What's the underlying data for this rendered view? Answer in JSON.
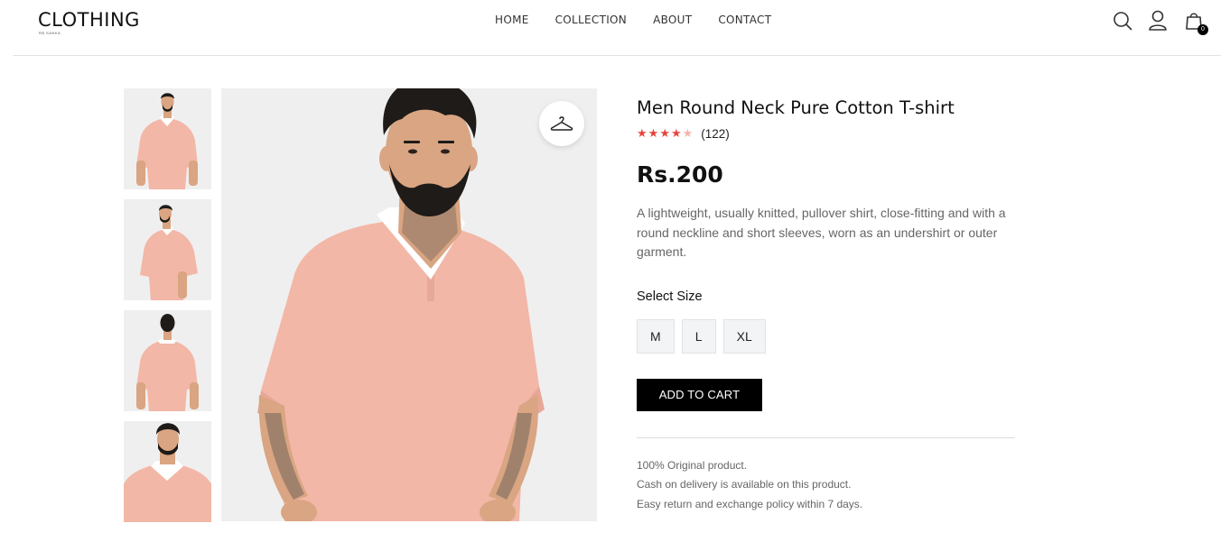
{
  "header": {
    "logo_text": "CLOTHING",
    "logo_sub": "RB SANKA",
    "nav": [
      "HOME",
      "COLLECTION",
      "ABOUT",
      "CONTACT"
    ],
    "cart_count": "0",
    "icons": [
      "search-icon",
      "user-icon",
      "shopping-bag-icon"
    ]
  },
  "gallery": {
    "thumbnails": [
      "front view",
      "side view",
      "back view",
      "close-up view"
    ],
    "main_icon": "hanger-icon"
  },
  "product": {
    "title": "Men Round Neck Pure Cotton T-shirt",
    "rating": 4,
    "rating_max": 5,
    "review_count": "(122)",
    "price": "Rs.200",
    "description": "A lightweight, usually knitted, pullover shirt, close-fitting and with a round neckline and short sleeves, worn as an undershirt or outer garment.",
    "size_label": "Select Size",
    "sizes": [
      "M",
      "L",
      "XL"
    ],
    "add_to_cart": "ADD TO CART",
    "policies": [
      "100% Original product.",
      "Cash on delivery is available on this product.",
      "Easy return and exchange policy within 7 days."
    ]
  },
  "colors": {
    "accent": "#000000",
    "star": "#e8453c",
    "shirt": "#f2b7a7",
    "image_bg": "#efefef"
  }
}
